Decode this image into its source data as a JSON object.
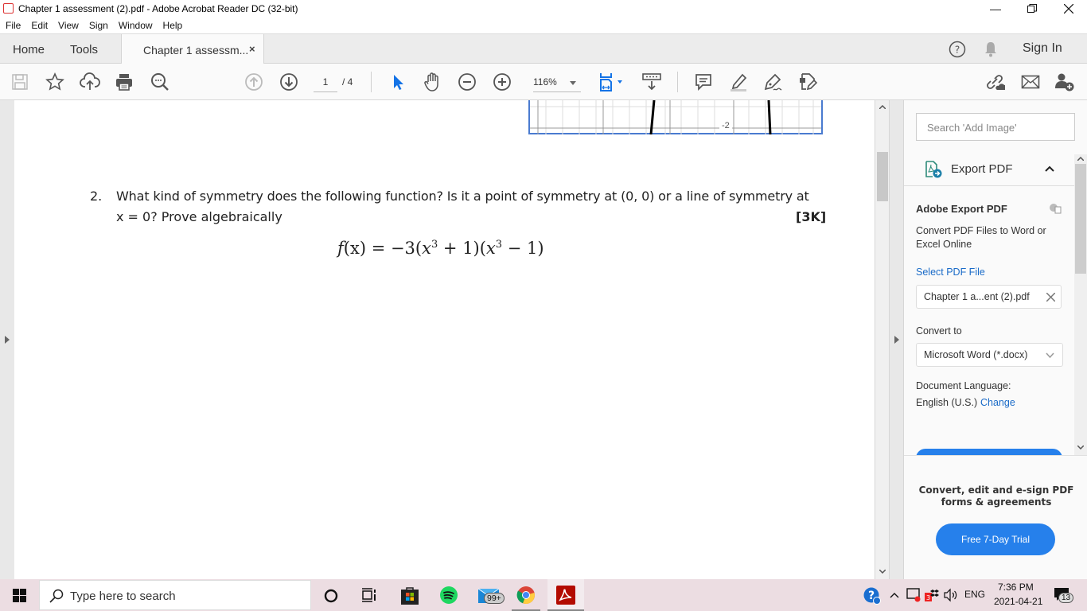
{
  "window": {
    "title": "Chapter 1 assessment (2).pdf - Adobe Acrobat Reader DC (32-bit)",
    "controls": [
      "minimize",
      "restore",
      "close"
    ]
  },
  "menu": [
    "File",
    "Edit",
    "View",
    "Sign",
    "Window",
    "Help"
  ],
  "tabs": {
    "home": "Home",
    "tools": "Tools",
    "document": "Chapter 1 assessm...",
    "close": "×",
    "sign_in": "Sign In"
  },
  "toolbar": {
    "page_current": "1",
    "page_total": "/ 4",
    "zoom": "116%"
  },
  "document": {
    "graph_label": "-2",
    "question_number": "2.",
    "question_line1": "What kind of symmetry does the following function? Is it a point of symmetry at (0, 0) or a line of symmetry at",
    "question_line2": "x = 0? Prove algebraically",
    "marks": "[3K]",
    "formula": {
      "lhs": "f",
      "arg": "(x)",
      "rhs_a": " = −3(",
      "x1": "x",
      "exp1": "3",
      "mid": " + 1)(",
      "x2": "x",
      "exp2": "3",
      "end": " − 1)"
    }
  },
  "right_panel": {
    "search_placeholder": "Search 'Add Image'",
    "export_title": "Export PDF",
    "section_title": "Adobe Export PDF",
    "description": "Convert PDF Files to Word or Excel Online",
    "select_label": "Select PDF File",
    "selected_file": "Chapter 1 a...ent (2).pdf",
    "convert_to_label": "Convert to",
    "convert_to_value": "Microsoft Word (*.docx)",
    "language_label": "Document Language:",
    "language_value": "English (U.S.)",
    "change_link": "Change",
    "promo_text": "Convert, edit and e-sign PDF forms & agreements",
    "trial_button": "Free 7-Day Trial"
  },
  "taskbar": {
    "search_placeholder": "Type here to search",
    "mail_badge": "99+",
    "language": "ENG",
    "time": "7:36 PM",
    "date": "2021-04-21",
    "notifications": "13"
  },
  "colors": {
    "accent": "#2680eb",
    "link": "#1a6bc8",
    "select_tool": "#1473e6"
  }
}
